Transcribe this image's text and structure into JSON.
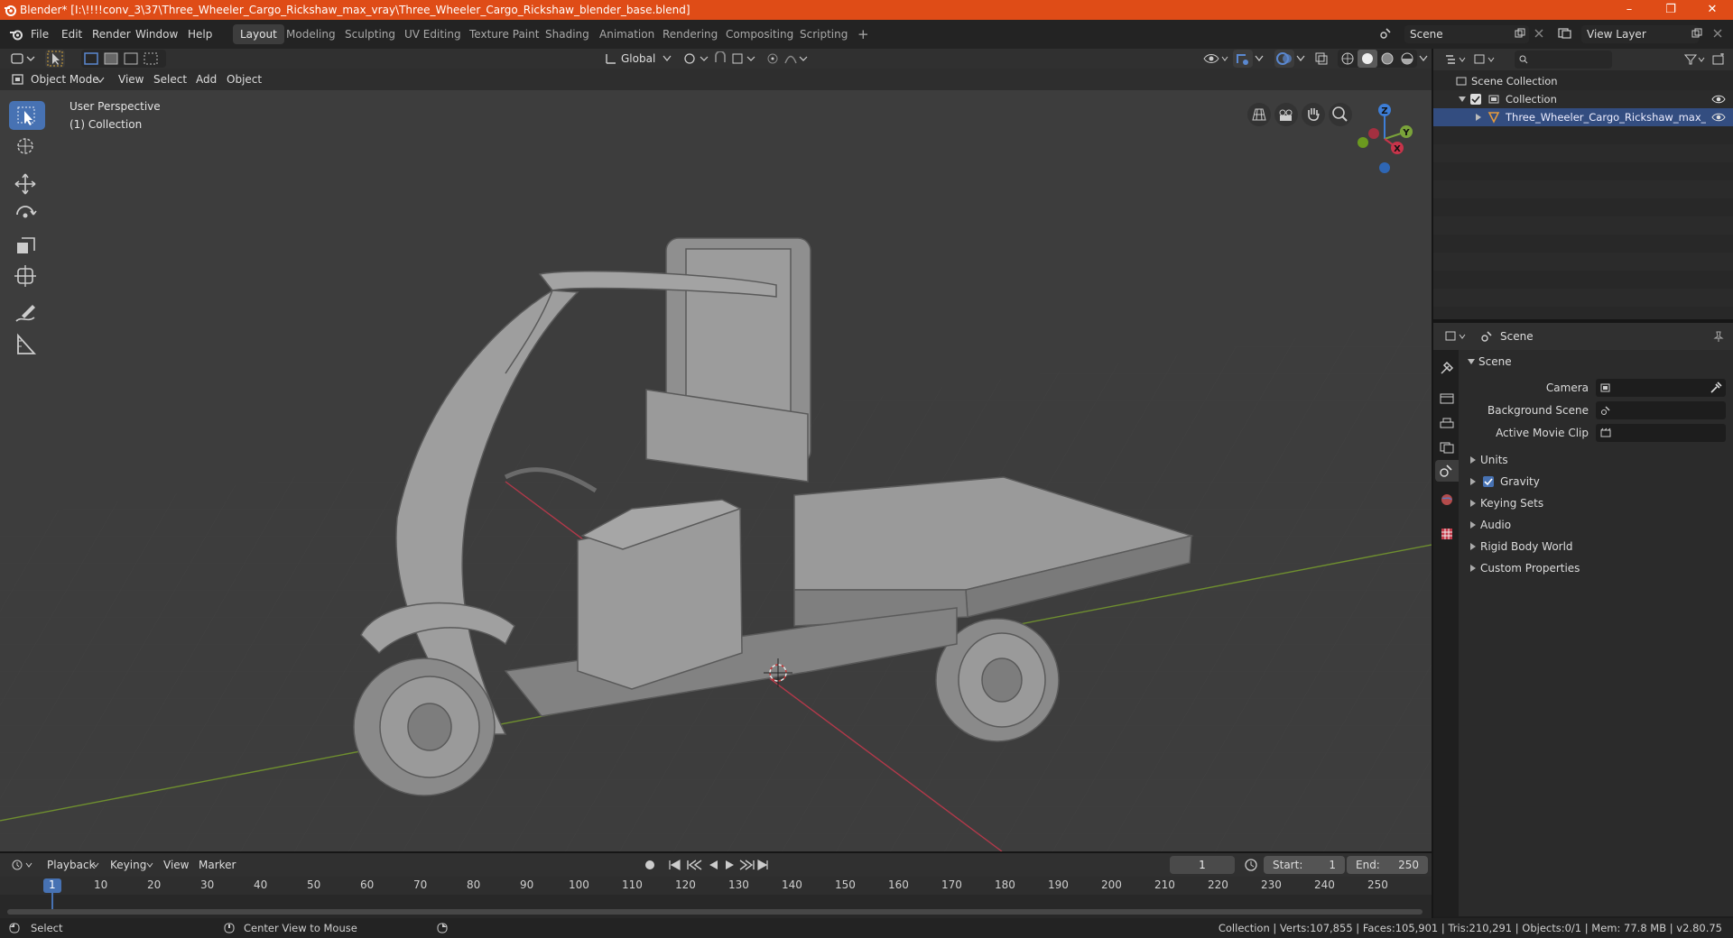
{
  "titlebar": {
    "title": "Blender* [I:\\!!!!conv_3\\37\\Three_Wheeler_Cargo_Rickshaw_max_vray\\Three_Wheeler_Cargo_Rickshaw_blender_base.blend]",
    "minimize": "–",
    "maximize": "❐",
    "close": "✕"
  },
  "menu": {
    "items": [
      "File",
      "Edit",
      "Render",
      "Window",
      "Help"
    ],
    "workspaces": [
      "Layout",
      "Modeling",
      "Sculpting",
      "UV Editing",
      "Texture Paint",
      "Shading",
      "Animation",
      "Rendering",
      "Compositing",
      "Scripting"
    ],
    "add_workspace": "+",
    "scene": "Scene",
    "view_layer": "View Layer"
  },
  "viewport": {
    "transform_orientation": "Global",
    "mode": "Object Mode",
    "menus": [
      "View",
      "Select",
      "Add",
      "Object"
    ],
    "info_line1": "User Perspective",
    "info_line2": "(1) Collection",
    "gizmo_axes": {
      "z": "Z",
      "y": "Y",
      "x": "X"
    }
  },
  "outliner": {
    "search_placeholder": "",
    "scene_collection": "Scene Collection",
    "collection": "Collection",
    "object": "Three_Wheeler_Cargo_Rickshaw_max_conv"
  },
  "properties": {
    "header": "Scene",
    "panel_title": "Scene",
    "camera_label": "Camera",
    "background_scene_label": "Background Scene",
    "active_movie_clip_label": "Active Movie Clip",
    "sections": [
      "Units",
      "Gravity",
      "Keying Sets",
      "Audio",
      "Rigid Body World",
      "Custom Properties"
    ],
    "gravity_checked": true
  },
  "timeline": {
    "menus": [
      "Playback",
      "Keying",
      "View",
      "Marker"
    ],
    "current_frame": "1",
    "start_label": "Start:",
    "start": "1",
    "end_label": "End:",
    "end": "250",
    "ruler": [
      "1",
      "10",
      "20",
      "30",
      "40",
      "50",
      "60",
      "70",
      "80",
      "90",
      "100",
      "110",
      "120",
      "130",
      "140",
      "150",
      "160",
      "170",
      "180",
      "190",
      "200",
      "210",
      "220",
      "230",
      "240",
      "250"
    ]
  },
  "statusbar": {
    "left_action": "Select",
    "middle_action": "Center View to Mouse",
    "stats": "Collection | Verts:107,855 | Faces:105,901 | Tris:210,291 | Objects:0/1 | Mem: 77.8 MB | v2.80.75"
  },
  "colors": {
    "title_bar": "#df4c17",
    "accent_blue": "#4772b3",
    "selected_row": "#334d80",
    "axis_x": "#c8344a",
    "axis_y": "#7aa33a",
    "axis_z": "#3d7ed8"
  }
}
